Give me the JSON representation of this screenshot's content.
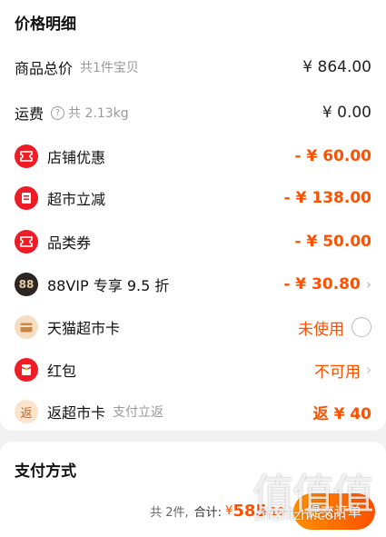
{
  "price_detail": {
    "title": "价格明细",
    "goods_total": {
      "label": "商品总价",
      "sub": "共1件宝贝",
      "value": "¥ 864.00"
    },
    "shipping": {
      "label": "运费",
      "sub": "共 2.13kg",
      "value": "¥ 0.00",
      "help_icon": "?"
    },
    "discounts": [
      {
        "label": "店铺优惠",
        "value": "- ¥ 60.00",
        "icon": "coupon-icon",
        "icon_color": "#ee1c25"
      },
      {
        "label": "超市立减",
        "value": "- ¥ 138.00",
        "icon": "tag-icon",
        "icon_color": "#ee1c25"
      },
      {
        "label": "品类券",
        "value": "- ¥ 50.00",
        "icon": "coupon-icon",
        "icon_color": "#ee1c25"
      },
      {
        "label": "88VIP 专享 9.5 折",
        "value": "- ¥ 30.80",
        "icon": "vip-88-icon",
        "icon_color": "#2b2623",
        "icon_text": "88"
      }
    ],
    "tmall_card": {
      "label": "天猫超市卡",
      "value": "未使用",
      "icon": "card-icon",
      "icon_color": "#f6dcc0"
    },
    "red_packet": {
      "label": "红包",
      "value": "不可用",
      "icon": "red-packet-icon",
      "icon_color": "#ee1c25"
    },
    "cashback_card": {
      "label": "返超市卡",
      "sub": "支付立返",
      "value": "返 ¥ 40",
      "icon_text": "返",
      "icon_color": "#fbe3cc"
    }
  },
  "payment": {
    "title": "支付方式"
  },
  "bottom_bar": {
    "count_text": "共 2件,",
    "total_label": "合计:",
    "currency": "¥",
    "amount_int": "585",
    "amount_dec": ".10",
    "submit_label": "提交订单"
  },
  "watermark": {
    "glyphs": "值值值",
    "text": "zhizhizhi.com"
  },
  "colors": {
    "accent": "#ff5000",
    "red": "#ee1c25"
  }
}
